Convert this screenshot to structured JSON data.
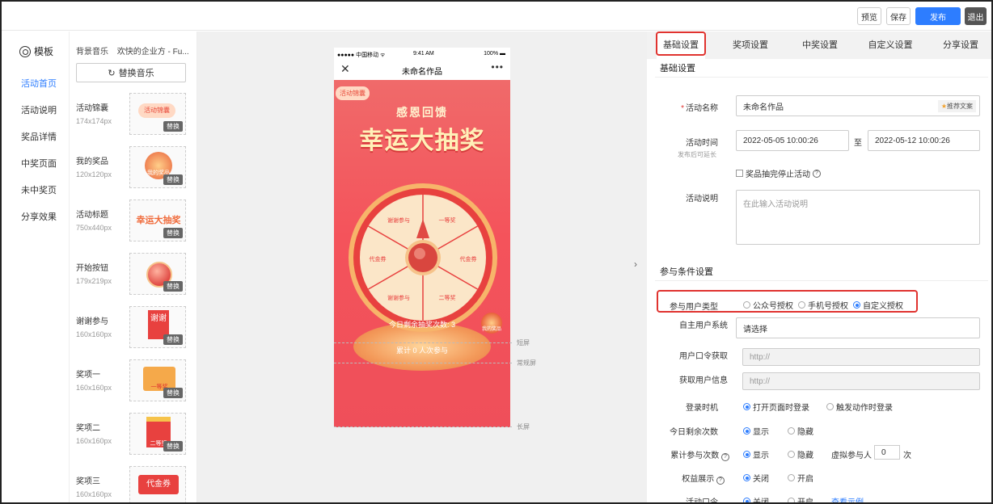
{
  "topbar": {
    "preview": "预览",
    "save": "保存",
    "publish": "发布",
    "exit": "退出"
  },
  "leftnav": {
    "logo": "模板",
    "items": [
      {
        "label": "活动首页",
        "active": true
      },
      {
        "label": "活动说明"
      },
      {
        "label": "奖品详情"
      },
      {
        "label": "中奖页面"
      },
      {
        "label": "未中奖页"
      },
      {
        "label": "分享效果"
      }
    ]
  },
  "assets": {
    "music_label": "背景音乐",
    "music_name": "欢快的企业方 - Fu...",
    "replace_music": "替换音乐",
    "swap_label": "替换",
    "items": [
      {
        "name": "活动锦囊",
        "size": "174x174px",
        "thumb_text": "活动锦囊"
      },
      {
        "name": "我的奖品",
        "size": "120x120px",
        "thumb_text": "我的奖品"
      },
      {
        "name": "活动标题",
        "size": "750x440px",
        "thumb_text": "幸运大抽奖"
      },
      {
        "name": "开始按钮",
        "size": "179x219px",
        "thumb_text": ""
      },
      {
        "name": "谢谢参与",
        "size": "160x160px",
        "thumb_text": "谢谢"
      },
      {
        "name": "奖项一",
        "size": "160x160px",
        "thumb_text": "一等奖"
      },
      {
        "name": "奖项二",
        "size": "160x160px",
        "thumb_text": "二等奖"
      },
      {
        "name": "奖项三",
        "size": "160x160px",
        "thumb_text": "代金券"
      }
    ]
  },
  "phone": {
    "carrier": "●●●●● 中国移动 ᯤ",
    "time": "9:41 AM",
    "battery": "100% ▬",
    "close": "✕",
    "title": "未命名作品",
    "more": "•••",
    "tag": "活动锦囊",
    "subtitle": "感恩回馈",
    "headline": "幸运大抽奖",
    "remaining": "今日剩余抽奖次数: 3",
    "total": "累计 0 人次参与",
    "my_prize": "我的奖品",
    "wheel_labels": [
      "一等奖",
      "代金券",
      "二等奖",
      "谢谢参与",
      "代金券",
      "谢谢参与"
    ]
  },
  "screen_marks": {
    "short": "短屏",
    "normal": "常规屏",
    "long": "长屏"
  },
  "panel": {
    "tabs": [
      "基础设置",
      "奖项设置",
      "中奖设置",
      "自定义设置",
      "分享设置"
    ],
    "basic_title": "基础设置",
    "name_label": "活动名称",
    "name_value": "未命名作品",
    "recommend": "推荐文案",
    "time_label": "活动时间",
    "time_sub": "发布后可延长",
    "start": "2022-05-05 10:00:26",
    "to": "至",
    "end": "2022-05-12 10:00:26",
    "stop_check": "奖品抽完停止活动",
    "desc_label": "活动说明",
    "desc_placeholder": "在此输入活动说明",
    "cond_title": "参与条件设置",
    "user_type_label": "参与用户类型",
    "user_types": [
      "公众号授权",
      "手机号授权",
      "自定义授权"
    ],
    "user_system_label": "自主用户系统",
    "user_system_value": "请选择",
    "token_label": "用户口令获取",
    "token_value": "http://",
    "info_label": "获取用户信息",
    "info_value": "http://",
    "login_label": "登录时机",
    "login_opts": [
      "打开页面时登录",
      "触发动作时登录"
    ],
    "today_label": "今日剩余次数",
    "show": "显示",
    "hide": "隐藏",
    "cum_label": "累计参与次数",
    "virtual_label": "虚拟参与人",
    "virtual_value": "0",
    "virtual_unit": "次",
    "rights_label": "权益展示",
    "off": "关闭",
    "on": "开启",
    "code_label": "活动口令",
    "example": "查看示例"
  }
}
